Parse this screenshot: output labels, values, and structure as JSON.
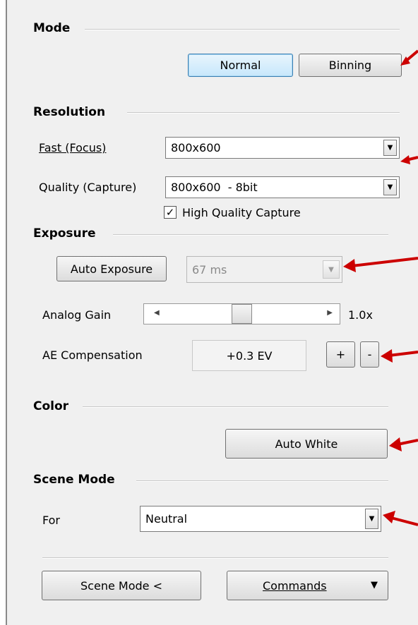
{
  "mode": {
    "title": "Mode",
    "normal_label": "Normal",
    "binning_label": "Binning"
  },
  "resolution": {
    "title": "Resolution",
    "fast_label": "Fast (Focus)",
    "fast_value": "800x600",
    "quality_label": "Quality (Capture)",
    "quality_value": "800x600  - 8bit",
    "hq_capture_label": "High Quality Capture",
    "hq_capture_checked": true
  },
  "exposure": {
    "title": "Exposure",
    "auto_label": "Auto Exposure",
    "time_value": "67 ms",
    "gain_label": "Analog Gain",
    "gain_value": "1.0x",
    "gain_level": 0.5,
    "ae_comp_label": "AE Compensation",
    "ae_comp_value": "+0.3 EV",
    "plus_label": "+",
    "minus_label": "-"
  },
  "color": {
    "title": "Color",
    "auto_white_label": "Auto White"
  },
  "scene": {
    "title": "Scene Mode",
    "for_label": "For",
    "for_value": "Neutral"
  },
  "footer": {
    "scene_mode_button": "Scene Mode <",
    "commands_button": "Commands"
  },
  "colors": {
    "annotation_arrow": "#cc0000",
    "active_button": "#c7e7fb"
  }
}
